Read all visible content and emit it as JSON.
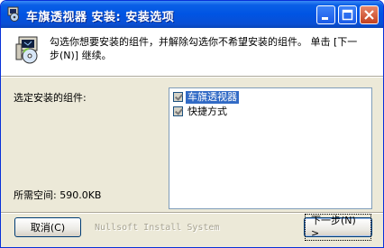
{
  "window": {
    "title": "车旗透视器 安装: 安装选项",
    "colors": {
      "titlebar": "#0054e3",
      "face": "#ece9d8",
      "close": "#c2401f"
    }
  },
  "header": {
    "instruction": "勾选你想要安装的组件，并解除勾选你不希望安装的组件。 单击 [下一步(N)] 继续。"
  },
  "components": {
    "label": "选定安装的组件:",
    "items": [
      {
        "label": "车旗透视器",
        "checked": true,
        "highlighted": true
      },
      {
        "label": "快捷方式",
        "checked": true,
        "highlighted": false
      }
    ]
  },
  "space": {
    "text": "所需空间: 590.0KB"
  },
  "footer": {
    "brand": "Nullsoft Install System",
    "cancel_label": "取消(C)",
    "next_label": "下一步(N) >"
  },
  "icons": [
    "installer-app-icon",
    "installer-disk-icon",
    "minimize-icon",
    "maximize-icon",
    "close-icon"
  ]
}
